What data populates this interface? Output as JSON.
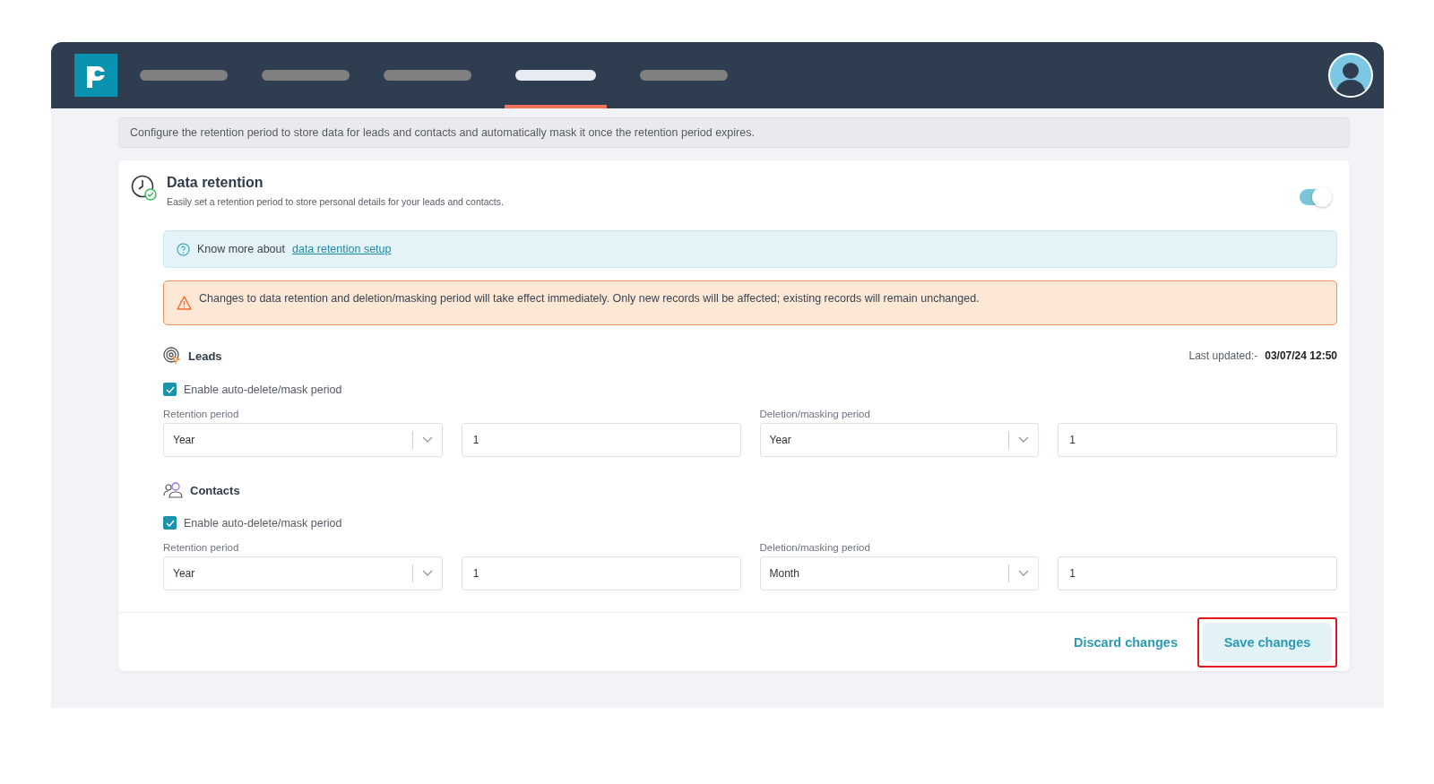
{
  "nav": {
    "tabs": [
      {
        "selected": false
      },
      {
        "selected": false
      },
      {
        "selected": false
      },
      {
        "selected": true
      },
      {
        "selected": false
      }
    ]
  },
  "info_banner": "Configure the retention period to store data for leads and contacts and automatically mask it once the retention period expires.",
  "card": {
    "title": "Data retention",
    "subtitle": "Easily set a retention period to store personal details for your leads and contacts.",
    "toggle_on": true,
    "help": {
      "text": "Know more about",
      "link": "data retention setup"
    },
    "warning": "Changes to data retention and deletion/masking period will take effect immediately. Only new records will be affected; existing records will remain unchanged.",
    "sections": [
      {
        "kind": "leads",
        "title": "Leads",
        "last_updated_label": "Last updated:-",
        "last_updated_value": "03/07/24 12:50",
        "checkbox": {
          "label": "Enable auto-delete/mask period",
          "checked": true
        },
        "groups": [
          {
            "label": "Retention period",
            "unit": "Year",
            "value": "1"
          },
          {
            "label": "Deletion/masking period",
            "unit": "Year",
            "value": "1"
          }
        ]
      },
      {
        "kind": "contacts",
        "title": "Contacts",
        "checkbox": {
          "label": "Enable auto-delete/mask period",
          "checked": true
        },
        "groups": [
          {
            "label": "Retention period",
            "unit": "Year",
            "value": "1"
          },
          {
            "label": "Deletion/masking period",
            "unit": "Month",
            "value": "1"
          }
        ]
      }
    ],
    "footer": {
      "discard": "Discard changes",
      "save": "Save changes",
      "save_highlighted": true
    }
  }
}
